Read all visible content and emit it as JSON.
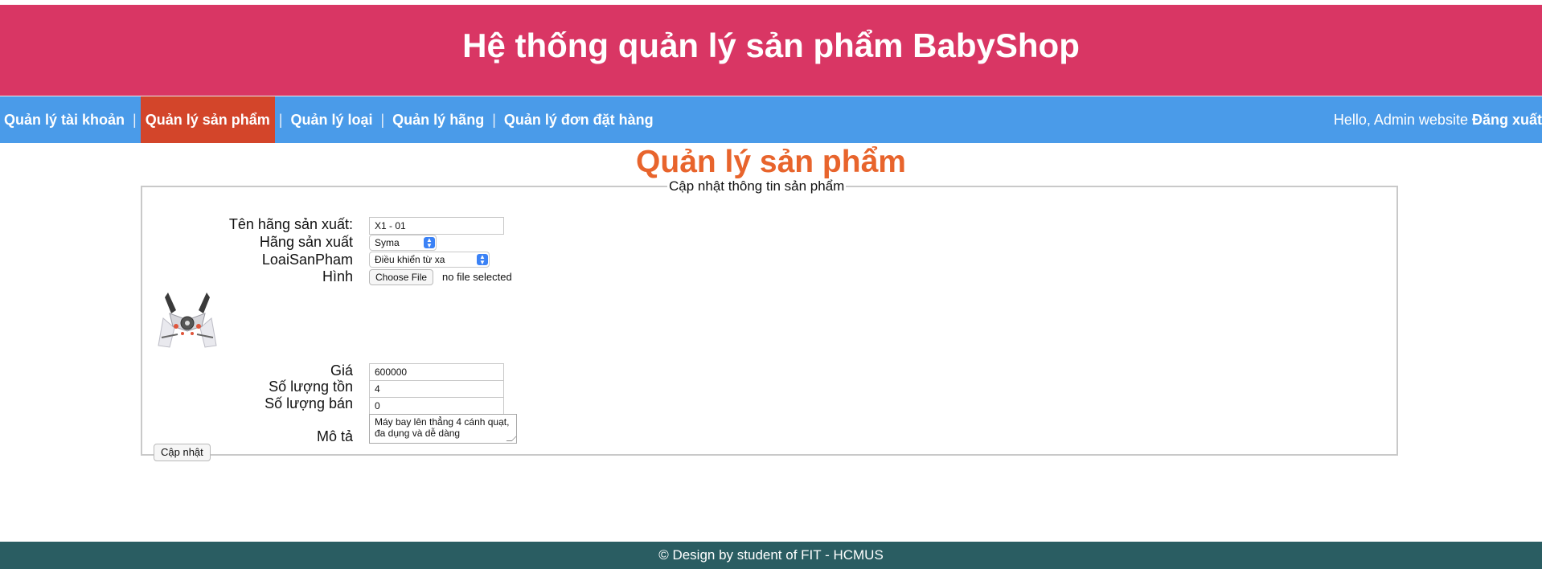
{
  "header": {
    "title": "Hệ thống quản lý sản phẩm BabyShop"
  },
  "nav": {
    "items": [
      {
        "label": "Quản lý tài khoản"
      },
      {
        "label": "Quản lý sản phẩm",
        "active": true
      },
      {
        "label": "Quản lý loại"
      },
      {
        "label": "Quản lý hãng"
      },
      {
        "label": "Quản lý đơn đặt hàng"
      }
    ],
    "separator": "|",
    "greeting": "Hello, Admin website",
    "logout": "Đăng xuất"
  },
  "page": {
    "title": "Quản lý sản phẩm",
    "legend": "Cập nhật thông tin sản phẩm"
  },
  "form": {
    "name_label": "Tên hãng sản xuất:",
    "name_value": "X1 - 01",
    "brand_label": "Hãng sản xuất",
    "brand_value": "Syma",
    "type_label": "LoaiSanPham",
    "type_value": "Điều khiển từ xa",
    "image_label": "Hình",
    "file_button": "Choose File",
    "file_status": "no file selected",
    "price_label": "Giá",
    "price_value": "600000",
    "stock_label": "Số lượng tồn",
    "stock_value": "4",
    "sold_label": "Số lượng bán",
    "sold_value": "0",
    "desc_label": "Mô tả",
    "desc_value": "Máy bay lên thẳng 4 cánh quạt, đa dụng và dễ dàng",
    "submit": "Cập nhật"
  },
  "footer": {
    "text": "© Design by student of FIT - HCMUS"
  },
  "colors": {
    "header_bg": "#d93664",
    "nav_bg": "#4a9be9",
    "nav_active_bg": "#d3452a",
    "title_color": "#e8642c",
    "footer_bg": "#2a5d62"
  }
}
